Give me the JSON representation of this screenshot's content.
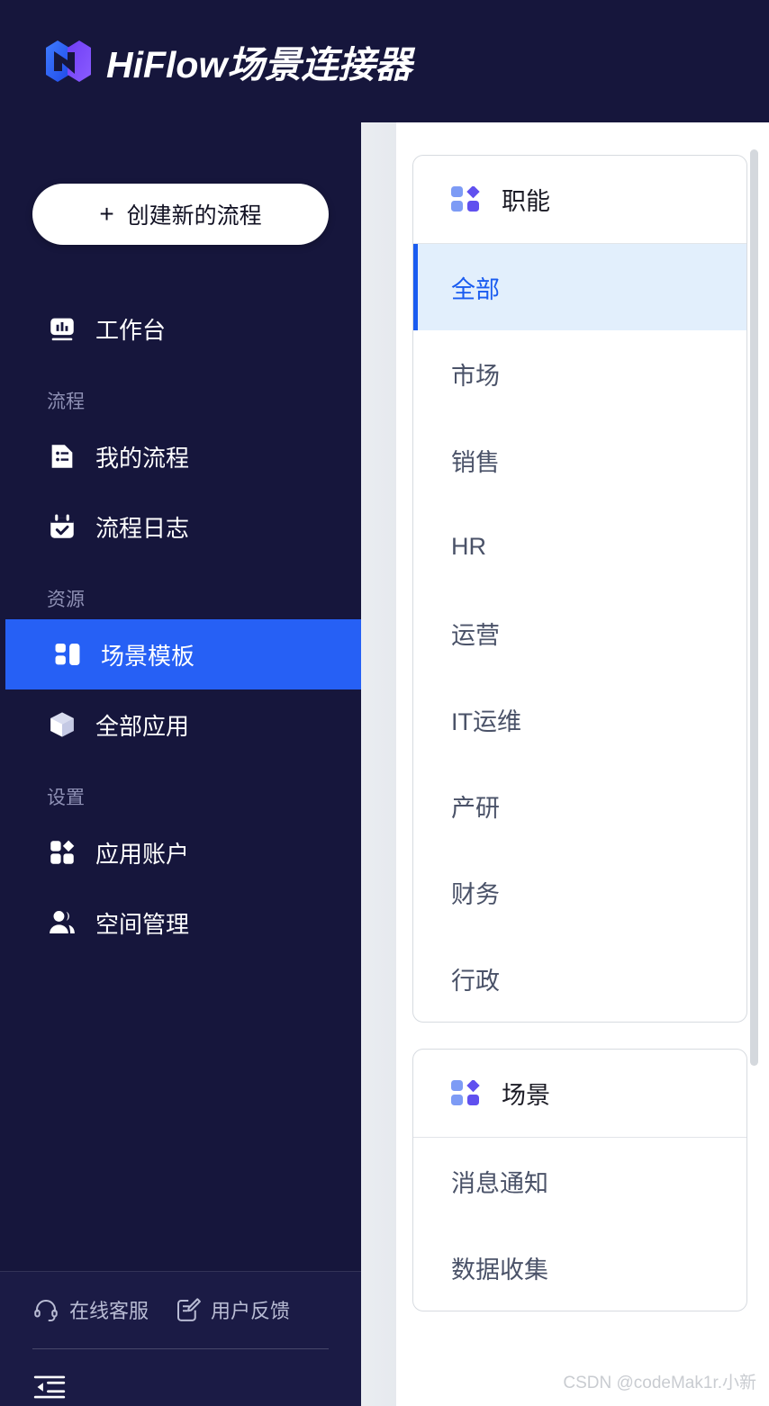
{
  "header": {
    "brand_title": "HiFlow场景连接器",
    "logo_icon": "hiflow-logo-icon",
    "bg_color": "#16163c",
    "logo_blue": "#2f6bff",
    "logo_purple": "#7b3cf0"
  },
  "sidebar": {
    "create_button": {
      "label": "创建新的流程",
      "plus_icon": "plus-icon"
    },
    "items": [
      {
        "type": "item",
        "label": "工作台",
        "icon": "dashboard-icon",
        "active": false
      },
      {
        "type": "group",
        "label": "流程"
      },
      {
        "type": "item",
        "label": "我的流程",
        "icon": "document-list-icon",
        "active": false
      },
      {
        "type": "item",
        "label": "流程日志",
        "icon": "calendar-check-icon",
        "active": false
      },
      {
        "type": "group",
        "label": "资源"
      },
      {
        "type": "item",
        "label": "场景模板",
        "icon": "layout-grid-icon",
        "active": true
      },
      {
        "type": "item",
        "label": "全部应用",
        "icon": "cube-icon",
        "active": false
      },
      {
        "type": "group",
        "label": "设置"
      },
      {
        "type": "item",
        "label": "应用账户",
        "icon": "apps-grid-icon",
        "active": false
      },
      {
        "type": "item",
        "label": "空间管理",
        "icon": "users-icon",
        "active": false
      }
    ],
    "footer": {
      "links": [
        {
          "label": "在线客服",
          "icon": "headset-icon"
        },
        {
          "label": "用户反馈",
          "icon": "feedback-edit-icon"
        }
      ],
      "collapse_icon": "collapse-sidebar-icon"
    },
    "active_color": "#2660f5",
    "group_label_color": "#8e90b4"
  },
  "content": {
    "cards": [
      {
        "title": "职能",
        "icon": "four-dot-grid-icon",
        "items": [
          {
            "label": "全部",
            "selected": true
          },
          {
            "label": "市场",
            "selected": false
          },
          {
            "label": "销售",
            "selected": false
          },
          {
            "label": "HR",
            "selected": false
          },
          {
            "label": "运营",
            "selected": false
          },
          {
            "label": "IT运维",
            "selected": false
          },
          {
            "label": "产研",
            "selected": false
          },
          {
            "label": "财务",
            "selected": false
          },
          {
            "label": "行政",
            "selected": false
          }
        ]
      },
      {
        "title": "场景",
        "icon": "four-dot-grid-icon",
        "items": [
          {
            "label": "消息通知",
            "selected": false
          },
          {
            "label": "数据收集",
            "selected": false
          }
        ]
      }
    ],
    "scrollbar": {
      "name": "vertical-scrollbar"
    },
    "selected_bg": "#e2effc",
    "selected_fg": "#1a5cf0"
  },
  "watermark": {
    "text": "CSDN @codeMak1r.小新"
  }
}
